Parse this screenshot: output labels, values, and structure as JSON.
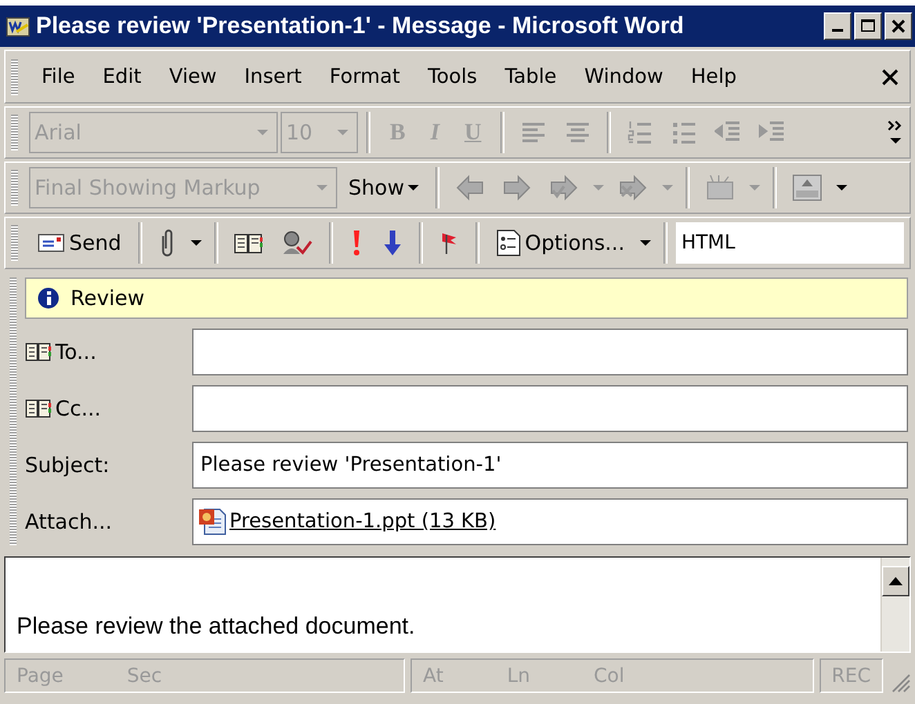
{
  "window": {
    "title": "Please review 'Presentation-1' - Message - Microsoft Word"
  },
  "menu": [
    {
      "label": "File"
    },
    {
      "label": "Edit"
    },
    {
      "label": "View"
    },
    {
      "label": "Insert"
    },
    {
      "label": "Format"
    },
    {
      "label": "Tools"
    },
    {
      "label": "Table"
    },
    {
      "label": "Window"
    },
    {
      "label": "Help"
    }
  ],
  "formatting_toolbar": {
    "disabled": true,
    "font": "Arial",
    "size": "10",
    "buttons": [
      {
        "label": "B",
        "kind": "bold"
      },
      {
        "label": "I",
        "kind": "italic"
      },
      {
        "label": "U",
        "kind": "underline"
      }
    ]
  },
  "reviewing_toolbar": {
    "display": "Final Showing Markup",
    "display_disabled": true,
    "show": {
      "label": "Show"
    }
  },
  "email_toolbar": {
    "send": {
      "label": "Send"
    },
    "options": {
      "label": "Options..."
    },
    "format": "HTML"
  },
  "info_bar": {
    "text": "Review"
  },
  "fields": [
    {
      "label": "To...",
      "kind": "address"
    },
    {
      "label": "Cc...",
      "kind": "address"
    },
    {
      "label": "Subject:",
      "kind": "text",
      "value": "Please review 'Presentation-1'"
    },
    {
      "label": "Attach...",
      "kind": "attachment",
      "value": "Presentation-1.ppt (13 KB)"
    }
  ],
  "body": {
    "text": "Please review the attached document."
  },
  "status_bar": [
    {
      "items": [
        "Page",
        "Sec"
      ]
    },
    {
      "items": [
        "At",
        "Ln",
        "Col"
      ]
    },
    {
      "items": [
        "REC"
      ]
    }
  ]
}
